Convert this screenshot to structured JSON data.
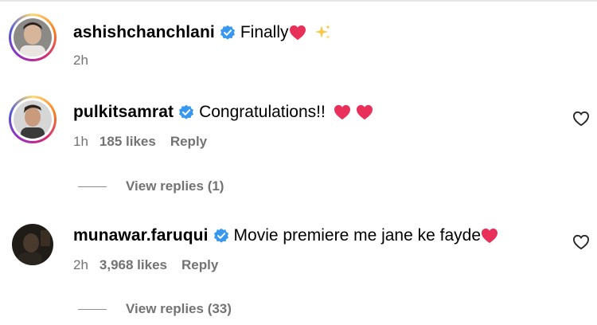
{
  "comments": [
    {
      "username": "ashishchanchlani",
      "text": "Finally",
      "time": "2h",
      "likes": "",
      "reply": ""
    },
    {
      "username": "pulkitsamrat",
      "text": "Congratulations!!",
      "time": "1h",
      "likes": "185 likes",
      "reply": "Reply",
      "view_replies": "View replies (1)"
    },
    {
      "username": "munawar.faruqui",
      "text": "Movie premiere me jane ke fayde",
      "time": "2h",
      "likes": "3,968 likes",
      "reply": "Reply",
      "view_replies": "View replies (33)"
    }
  ],
  "colors": {
    "verified": "#3897f0",
    "heart": "#e8305b",
    "muted_text": "#737373"
  },
  "icons": {
    "verified": "verified-badge-icon",
    "heart_emoji": "red-heart-emoji",
    "sparkle_emoji": "sparkles-emoji",
    "like": "heart-outline-icon"
  }
}
